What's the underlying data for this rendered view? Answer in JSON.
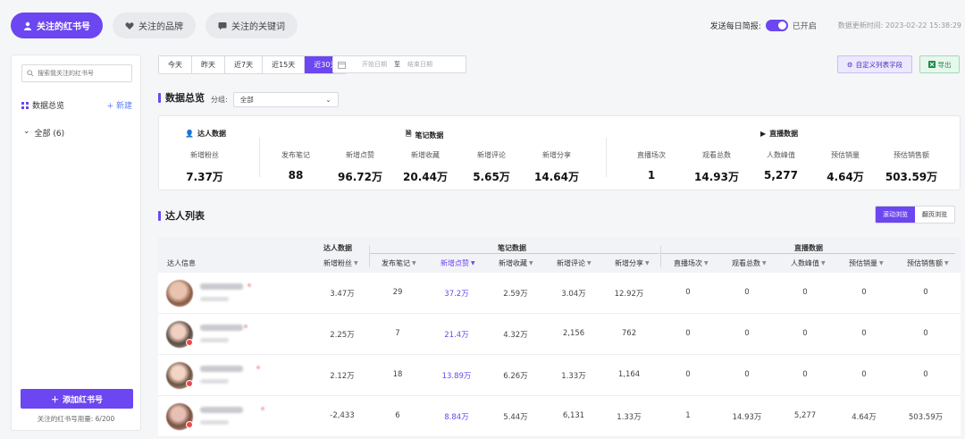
{
  "top_tabs": [
    {
      "label": "关注的红书号",
      "icon": "person-icon",
      "active": true
    },
    {
      "label": "关注的品牌",
      "icon": "heart-icon",
      "active": false
    },
    {
      "label": "关注的关键词",
      "icon": "chat-icon",
      "active": false
    }
  ],
  "daily_report": {
    "label": "发送每日简报:",
    "status": "已开启",
    "updated": "数据更新时间: 2023-02-22 15:38:29"
  },
  "sidebar": {
    "search_placeholder": "搜索我关注的红书号",
    "section_title": "数据总览",
    "new_label": "+ 新建",
    "group": "全部 (6)",
    "add_button": "添加红书号",
    "usage": "关注的红书号用量: 6/200"
  },
  "date_tabs": [
    "今天",
    "昨天",
    "近7天",
    "近15天",
    "近30天"
  ],
  "date_range": {
    "start": "开始日期",
    "sep": "至",
    "end": "结束日期"
  },
  "buttons": {
    "custom": "自定义列表字段",
    "export": "导出"
  },
  "overview": {
    "title": "数据总览",
    "group_label": "分组:",
    "group_value": "全部"
  },
  "summary": {
    "kol_head": "达人数据",
    "note_head": "笔记数据",
    "live_head": "直播数据",
    "items": [
      {
        "label": "新增粉丝",
        "value": "7.37万"
      },
      {
        "label": "发布笔记",
        "value": "88"
      },
      {
        "label": "新增点赞",
        "value": "96.72万"
      },
      {
        "label": "新增收藏",
        "value": "20.44万"
      },
      {
        "label": "新增评论",
        "value": "5.65万"
      },
      {
        "label": "新增分享",
        "value": "14.64万"
      },
      {
        "label": "直播场次",
        "value": "1"
      },
      {
        "label": "观看总数",
        "value": "14.93万"
      },
      {
        "label": "人数峰值",
        "value": "5,277"
      },
      {
        "label": "预估销量",
        "value": "4.64万"
      },
      {
        "label": "预估销售额",
        "value": "503.59万"
      }
    ]
  },
  "list": {
    "title": "达人列表",
    "view_scroll": "滚动浏览",
    "view_page": "翻页浏览"
  },
  "table": {
    "group_kol": "达人数据",
    "group_note": "笔记数据",
    "group_live": "直播数据",
    "info_col": "达人信息",
    "columns": [
      "新增粉丝",
      "发布笔记",
      "新增点赞",
      "新增收藏",
      "新增评论",
      "新增分享",
      "直播场次",
      "观看总数",
      "人数峰值",
      "预估销量",
      "预估销售额"
    ],
    "sorted_column": 2,
    "rows": [
      [
        "3.47万",
        "29",
        "37.2万",
        "2.59万",
        "3.04万",
        "12.92万",
        "0",
        "0",
        "0",
        "0",
        "0"
      ],
      [
        "2.25万",
        "7",
        "21.4万",
        "4.32万",
        "2,156",
        "762",
        "0",
        "0",
        "0",
        "0",
        "0"
      ],
      [
        "2.12万",
        "18",
        "13.89万",
        "6.26万",
        "1.33万",
        "1,164",
        "0",
        "0",
        "0",
        "0",
        "0"
      ],
      [
        "-2,433",
        "6",
        "8.84万",
        "5.44万",
        "6,131",
        "1.33万",
        "1",
        "14.93万",
        "5,277",
        "4.64万",
        "503.59万"
      ]
    ]
  },
  "colors": {
    "accent": "#6c46f0",
    "link": "#5b7ff7",
    "export": "#1f8a46"
  }
}
